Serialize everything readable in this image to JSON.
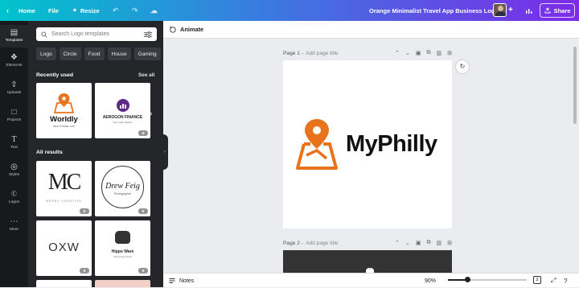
{
  "topbar": {
    "home_label": "Home",
    "file_label": "File",
    "resize_label": "Resize",
    "document_title": "Orange Minimalist Travel App Business Logo",
    "share_label": "Share"
  },
  "rail": {
    "items": [
      {
        "label": "Templates",
        "icon": "templates-icon"
      },
      {
        "label": "Elements",
        "icon": "elements-icon"
      },
      {
        "label": "Uploads",
        "icon": "upload-icon"
      },
      {
        "label": "Projects",
        "icon": "folder-icon"
      },
      {
        "label": "Text",
        "icon": "text-icon"
      },
      {
        "label": "Styles",
        "icon": "palette-icon"
      },
      {
        "label": "Logos",
        "icon": "logos-icon"
      },
      {
        "label": "More",
        "icon": "more-icon"
      }
    ]
  },
  "panel": {
    "search_placeholder": "Search Logo templates",
    "chips": [
      "Logo",
      "Circle",
      "Food",
      "House",
      "Gaming"
    ],
    "recently_used_label": "Recently used",
    "see_all_label": "See all",
    "all_results_label": "All results",
    "recent": [
      {
        "name": "Worldly",
        "tagline": "BEST TRAVEL APP"
      },
      {
        "name": "AEROGON FINANCE",
        "tagline": "Your Cash Partner"
      }
    ],
    "results": [
      {
        "name": "MC",
        "tagline": "MERRY CREATIVE"
      },
      {
        "name": "Drew Feig",
        "tagline": "Photographer"
      },
      {
        "name": "OXW",
        "tagline": ""
      },
      {
        "name": "Hippo Ware",
        "tagline": "Technology Studio"
      }
    ]
  },
  "toolbar": {
    "animate_label": "Animate"
  },
  "pages": [
    {
      "label": "Page 1",
      "title_placeholder": "Add page title"
    },
    {
      "label": "Page 2",
      "title_placeholder": "Add page title"
    }
  ],
  "canvas": {
    "logo_text": "MyPhilly",
    "brand_color": "#e8731c"
  },
  "bottombar": {
    "notes_label": "Notes",
    "zoom": "90%",
    "page_count": "2",
    "zoom_fraction": 0.25
  }
}
